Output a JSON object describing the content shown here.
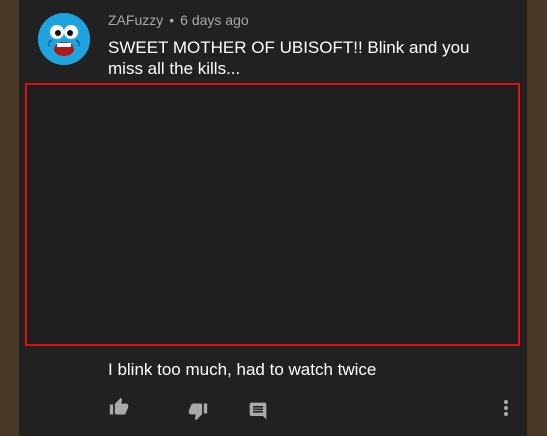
{
  "comment": {
    "author": "ZAFuzzy",
    "separator": "•",
    "time_ago": "6 days ago",
    "text": "SWEET MOTHER OF UBISOFT!! Blink and you miss all the kills..."
  },
  "reply": {
    "text": "I blink too much, had to watch twice"
  },
  "actions": {
    "like_icon": "thumb-up-icon",
    "dislike_icon": "thumb-down-icon",
    "reply_icon": "comment-icon",
    "more_icon": "more-vert-icon"
  },
  "colors": {
    "background": "#212121",
    "frame": "#4a3826",
    "highlight_border": "#e01010",
    "avatar": "#1fa4e0",
    "secondary_text": "#aaaaaa",
    "primary_text": "#ffffff"
  }
}
